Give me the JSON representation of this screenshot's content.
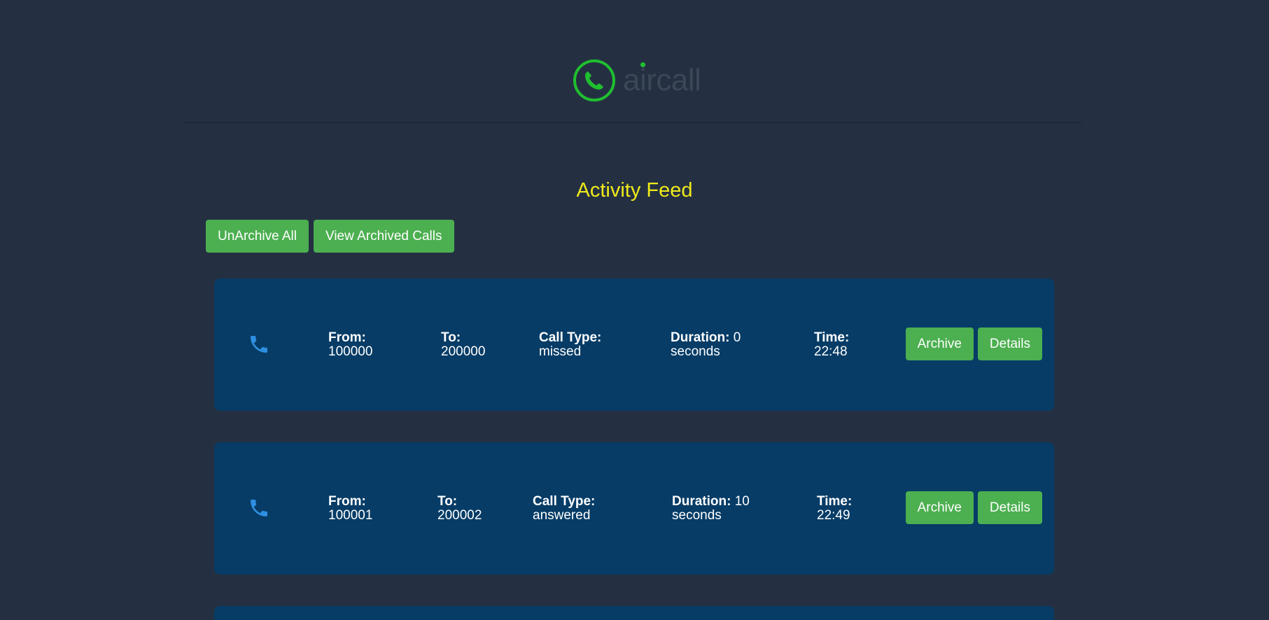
{
  "brand": {
    "name": "aircall",
    "accent_color": "#1fbf2f"
  },
  "feed": {
    "title": "Activity Feed"
  },
  "toolbar": {
    "unarchive_label": "UnArchive All",
    "view_archived_label": "View Archived Calls"
  },
  "labels": {
    "from": "From:",
    "to": "To:",
    "call_type": "Call Type:",
    "duration": "Duration:",
    "time": "Time:",
    "archive": "Archive",
    "details": "Details"
  },
  "calls": [
    {
      "icon": "phone-icon",
      "from": "100000",
      "to": "200000",
      "call_type": "missed",
      "duration_value": "0",
      "duration_unit": "seconds",
      "time": "22:48"
    },
    {
      "icon": "phone-icon",
      "from": "100001",
      "to": "200002",
      "call_type": "answered",
      "duration_value": "10",
      "duration_unit": "seconds",
      "time": "22:49"
    }
  ],
  "colors": {
    "background": "#243042",
    "card": "#063c66",
    "button": "#4caf50",
    "title": "#f0ea1a",
    "phone_icon": "#2e8fe0"
  }
}
